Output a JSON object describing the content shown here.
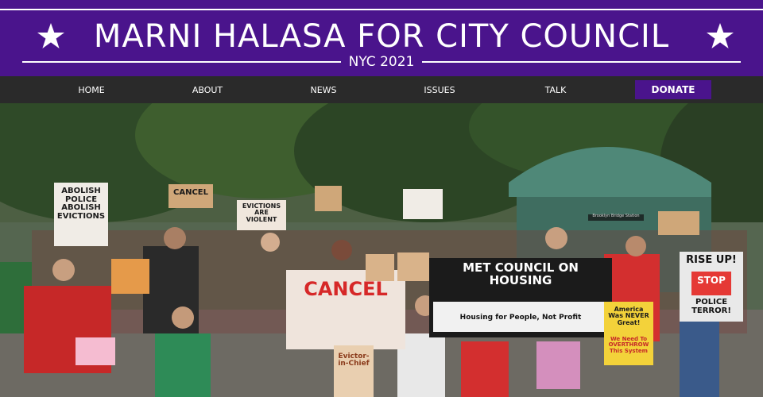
{
  "header": {
    "title": "MARNI HALASA FOR CITY COUNCIL",
    "subtitle": "NYC 2021",
    "star_color": "#ffffff",
    "brand_color": "#4a148c"
  },
  "nav": {
    "items": [
      {
        "label": "HOME"
      },
      {
        "label": "ABOUT"
      },
      {
        "label": "NEWS"
      },
      {
        "label": "ISSUES"
      },
      {
        "label": "TALK"
      }
    ],
    "donate_label": "DONATE"
  },
  "hero": {
    "signs": {
      "met_council": "MET COUNCIL ON HOUSING",
      "met_council_sub": "Housing for People, Not Profit",
      "cancel": "CANCEL",
      "rise_up": "RISE UP!",
      "stop": "STOP",
      "police_terror": "POLICE TERROR!",
      "abolish": "ABOLISH POLICE ABOLISH EVICTIONS",
      "evictions": "EVICTIONS ARE VIOLENT",
      "america": "America Was NEVER Great!",
      "overthrow": "We Need To OVERTHROW This System",
      "evictor": "Evictor-in-Chief",
      "cancel_small": "CANCEL",
      "station": "Brooklyn Bridge Station"
    }
  }
}
